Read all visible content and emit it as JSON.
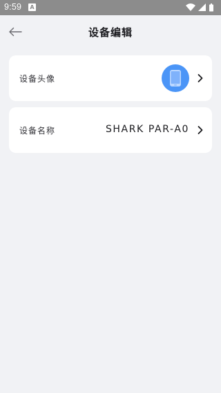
{
  "status_bar": {
    "time": "9:59",
    "notification_badge": "A",
    "icons": [
      "wifi-icon",
      "signal-icon",
      "battery-icon"
    ]
  },
  "header": {
    "title": "设备编辑",
    "back_icon": "arrow-left-icon"
  },
  "settings": {
    "avatar_row": {
      "label": "设备头像",
      "avatar_icon": "phone-icon",
      "avatar_color": "#4b95f7"
    },
    "name_row": {
      "label": "设备名称",
      "value": "SHARK PAR-A0"
    }
  },
  "colors": {
    "background": "#f1f2f5",
    "card": "#ffffff",
    "status_bar": "#8c8c8c"
  }
}
